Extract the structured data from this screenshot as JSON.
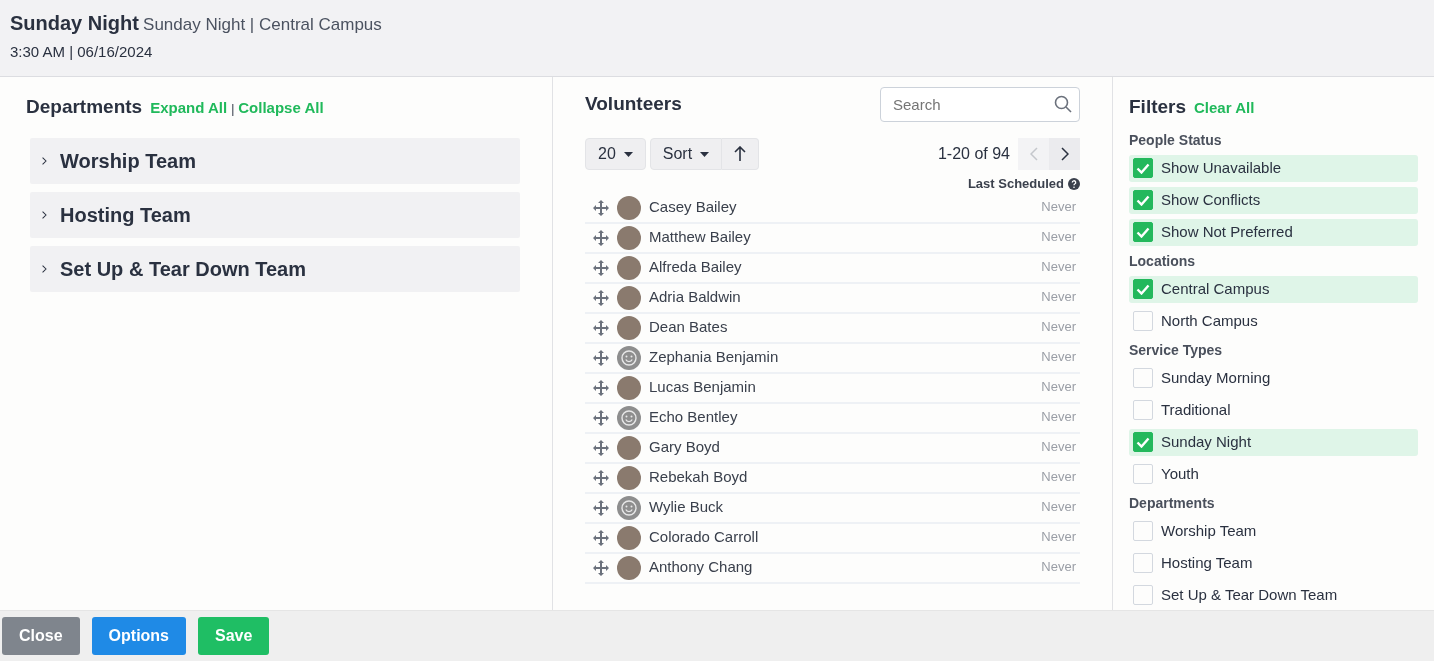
{
  "header": {
    "title": "Sunday Night",
    "subtitle": "Sunday Night | Central Campus",
    "datetime": "3:30 AM | 06/16/2024"
  },
  "departments": {
    "title": "Departments",
    "expand_all": "Expand All",
    "separator": "|",
    "collapse_all": "Collapse All",
    "items": [
      {
        "label": "Worship Team",
        "expanded": false
      },
      {
        "label": "Hosting Team",
        "expanded": false
      },
      {
        "label": "Set Up & Tear Down Team",
        "expanded": false
      }
    ]
  },
  "volunteers": {
    "title": "Volunteers",
    "search": {
      "placeholder": "Search"
    },
    "page_size": "20",
    "sort": "Sort",
    "range": "1-20 of 94",
    "column_header": "Last Scheduled",
    "rows": [
      {
        "name": "Casey Bailey",
        "kind": "photo",
        "last": "Never"
      },
      {
        "name": "Matthew Bailey",
        "kind": "photo",
        "last": "Never"
      },
      {
        "name": "Alfreda Bailey",
        "kind": "photo",
        "last": "Never"
      },
      {
        "name": "Adria Baldwin",
        "kind": "photo",
        "last": "Never"
      },
      {
        "name": "Dean Bates",
        "kind": "photo",
        "last": "Never"
      },
      {
        "name": "Zephania Benjamin",
        "kind": "default",
        "last": "Never"
      },
      {
        "name": "Lucas Benjamin",
        "kind": "photo",
        "last": "Never"
      },
      {
        "name": "Echo Bentley",
        "kind": "default",
        "last": "Never"
      },
      {
        "name": "Gary Boyd",
        "kind": "photo",
        "last": "Never"
      },
      {
        "name": "Rebekah Boyd",
        "kind": "photo",
        "last": "Never"
      },
      {
        "name": "Wylie Buck",
        "kind": "default",
        "last": "Never"
      },
      {
        "name": "Colorado Carroll",
        "kind": "photo",
        "last": "Never"
      },
      {
        "name": "Anthony Chang",
        "kind": "photo",
        "last": "Never"
      }
    ]
  },
  "filters": {
    "title": "Filters",
    "clear_all": "Clear All",
    "groups": [
      {
        "title": "People Status",
        "options": [
          {
            "label": "Show Unavailable",
            "checked": true
          },
          {
            "label": "Show Conflicts",
            "checked": true
          },
          {
            "label": "Show Not Preferred",
            "checked": true
          }
        ]
      },
      {
        "title": "Locations",
        "options": [
          {
            "label": "Central Campus",
            "checked": true
          },
          {
            "label": "North Campus",
            "checked": false
          }
        ]
      },
      {
        "title": "Service Types",
        "options": [
          {
            "label": "Sunday Morning",
            "checked": false
          },
          {
            "label": "Traditional",
            "checked": false
          },
          {
            "label": "Sunday Night",
            "checked": true
          },
          {
            "label": "Youth",
            "checked": false
          }
        ]
      },
      {
        "title": "Departments",
        "options": [
          {
            "label": "Worship Team",
            "checked": false
          },
          {
            "label": "Hosting Team",
            "checked": false
          },
          {
            "label": "Set Up & Tear Down Team",
            "checked": false
          }
        ]
      }
    ]
  },
  "footer": {
    "buttons": [
      {
        "label": "Close",
        "kind": "secondary"
      },
      {
        "label": "Options",
        "kind": "primary"
      },
      {
        "label": "Save",
        "kind": "success"
      }
    ]
  }
}
